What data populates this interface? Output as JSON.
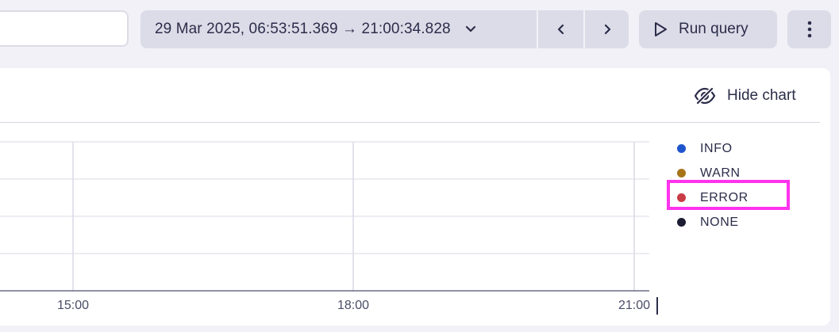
{
  "toolbar": {
    "search_value": "",
    "time_range_label": "29 Mar 2025, 06:53:51.369 → 21:00:34.828",
    "run_query_label": "Run query"
  },
  "chart_header": {
    "hide_chart_label": "Hide chart"
  },
  "legend": {
    "items": [
      {
        "label": "INFO",
        "color": "#1f55cc"
      },
      {
        "label": "WARN",
        "color": "#a8741a"
      },
      {
        "label": "ERROR",
        "color": "#c93b45"
      },
      {
        "label": "NONE",
        "color": "#1c1d33"
      }
    ]
  },
  "chart_data": {
    "type": "line",
    "x_ticks": [
      "15:00",
      "18:00",
      "21:00"
    ],
    "series": [],
    "grid": true,
    "legend_position": "right"
  },
  "colors": {
    "background": "#f1f1f7",
    "button_bg": "#dcdce8",
    "text": "#2b2d4a",
    "highlight": "#ff33ee"
  }
}
